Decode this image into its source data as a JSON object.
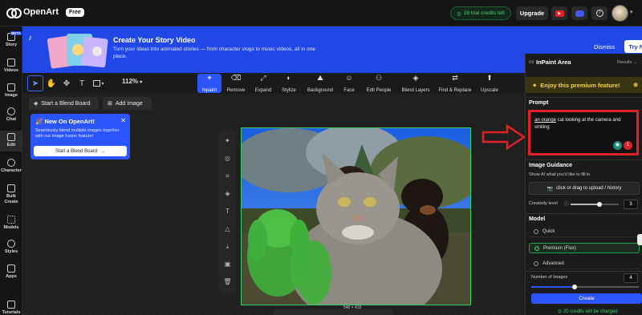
{
  "topbar": {
    "brand": "OpenArt",
    "plan_badge": "Free",
    "credits_label": "28 trial credits left",
    "upgrade_label": "Upgrade",
    "youtube_color": "#e0212a",
    "discord_color": "#4455ff"
  },
  "banner": {
    "title": "Create Your Story Video",
    "description": "Turn your ideas into animated stories — from character vlogs to music videos, all in one place.",
    "dismiss_label": "Dismiss",
    "try_now_label": "Try Now"
  },
  "leftnav": {
    "items": [
      {
        "label": "Story",
        "badge": "BETA"
      },
      {
        "label": "Videos"
      },
      {
        "label": "Image"
      },
      {
        "label": "Chat"
      },
      {
        "label": "Edit"
      },
      {
        "label": "Character"
      },
      {
        "label": "Bulk Create"
      },
      {
        "label": "Models"
      },
      {
        "label": "Styles"
      },
      {
        "label": "Apps"
      },
      {
        "label": "Tutorials"
      }
    ]
  },
  "toolbar": {
    "zoom": "112%",
    "tools": [
      {
        "label": "Inpaint",
        "icon": "wand-icon"
      },
      {
        "label": "Remove",
        "icon": "eraser-icon"
      },
      {
        "label": "Expand",
        "icon": "expand-icon"
      },
      {
        "label": "Stylize",
        "icon": "palette-icon"
      },
      {
        "label": "Background",
        "icon": "landscape-icon"
      },
      {
        "label": "Face",
        "icon": "face-icon"
      },
      {
        "label": "Edit People",
        "icon": "person-icon"
      },
      {
        "label": "Blend Layers",
        "icon": "layers-icon"
      },
      {
        "label": "Find & Replace",
        "icon": "find-replace-icon"
      },
      {
        "label": "Upscale",
        "icon": "upscale-icon"
      }
    ]
  },
  "canvas": {
    "blend_board_label": "Start a Blend Board",
    "add_image_label": "Add Image",
    "new_card": {
      "title": "New On OpenArt!",
      "description": "Seamlessly blend multiple images together with our image fusion feature!",
      "button_label": "Start a Blend Board"
    },
    "image_dims": "546 × 415"
  },
  "right_panel": {
    "title": "InPaint Area",
    "results_label": "Results",
    "premium_label": "Enjoy this premium feature!",
    "prompt_heading": "Prompt",
    "prompt_highlight": "an orange",
    "prompt_rest": " cat looking at the camera and smiling",
    "prompt_badge_count": "1",
    "guidance_heading": "Image Guidance",
    "guidance_hint": "Show AI what you'd like to fill in",
    "upload_label": "click or drag to upload / history",
    "creativity_label": "Creativity level",
    "creativity_value": "3",
    "creativity_fraction": 0.6,
    "model_heading": "Model",
    "models": [
      {
        "label": "Quick",
        "selected": false
      },
      {
        "label": "Premium (Flux)",
        "selected": true
      },
      {
        "label": "Advanced",
        "selected": false
      }
    ],
    "num_images_label": "Number of Images",
    "num_images_value": "4",
    "num_images_fraction": 0.4,
    "create_label": "Create",
    "charged_label": "20 credits will be charged"
  }
}
